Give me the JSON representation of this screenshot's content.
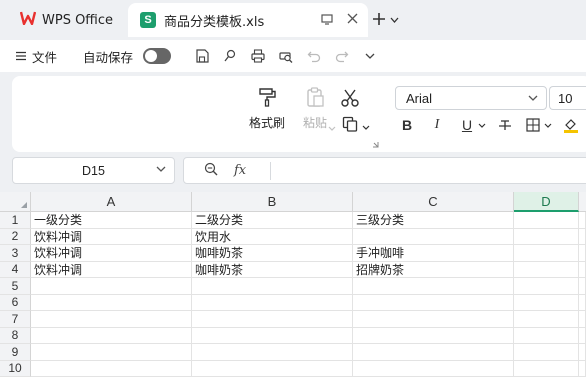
{
  "tabs": {
    "app_label": "WPS Office",
    "doc_label": "商品分类模板.xls",
    "doc_badge": "S"
  },
  "menubar": {
    "file_label": "文件",
    "autosave_label": "自动保存"
  },
  "ribbon": {
    "format_painter_label": "格式刷",
    "paste_label": "粘贴",
    "font_name": "Arial",
    "font_size": "10",
    "bold": "B",
    "italic": "I",
    "underline": "U"
  },
  "formula_bar": {
    "cell_ref": "D15",
    "fx_label": "fx",
    "value": ""
  },
  "sheet": {
    "columns": [
      "A",
      "B",
      "C",
      "D"
    ],
    "selected_column": "D",
    "rows": [
      {
        "num": "1",
        "cells": [
          "一级分类",
          "二级分类",
          "三级分类",
          ""
        ]
      },
      {
        "num": "2",
        "cells": [
          "饮料冲调",
          "饮用水",
          "",
          ""
        ]
      },
      {
        "num": "3",
        "cells": [
          "饮料冲调",
          "咖啡奶茶",
          "手冲咖啡",
          ""
        ]
      },
      {
        "num": "4",
        "cells": [
          "饮料冲调",
          "咖啡奶茶",
          "招牌奶茶",
          ""
        ]
      },
      {
        "num": "5",
        "cells": [
          "",
          "",
          "",
          ""
        ]
      },
      {
        "num": "6",
        "cells": [
          "",
          "",
          "",
          ""
        ]
      },
      {
        "num": "7",
        "cells": [
          "",
          "",
          "",
          ""
        ]
      },
      {
        "num": "8",
        "cells": [
          "",
          "",
          "",
          ""
        ]
      },
      {
        "num": "9",
        "cells": [
          "",
          "",
          "",
          ""
        ]
      },
      {
        "num": "10",
        "cells": [
          "",
          "",
          "",
          ""
        ]
      }
    ]
  },
  "colors": {
    "brand_red": "#e8302e",
    "sheet_green": "#1d9e6d",
    "selected_header_bg": "#dff1e7"
  }
}
